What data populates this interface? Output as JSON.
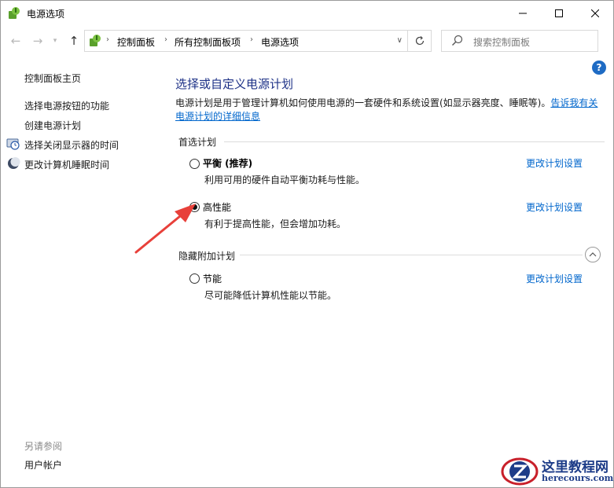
{
  "window": {
    "title": "电源选项",
    "controls": {
      "minimize_icon": "minimize-icon",
      "maximize_icon": "maximize-icon",
      "close_icon": "close-icon"
    }
  },
  "nav": {
    "breadcrumbs": [
      "控制面板",
      "所有控制面板项",
      "电源选项"
    ],
    "search_placeholder": "搜索控制面板"
  },
  "sidebar": {
    "home_link": "控制面板主页",
    "links": [
      {
        "label": "选择电源按钮的功能",
        "icon": ""
      },
      {
        "label": "创建电源计划",
        "icon": ""
      },
      {
        "label": "选择关闭显示器的时间",
        "icon": "display-clock-icon"
      },
      {
        "label": "更改计算机睡眠时间",
        "icon": "moon-icon"
      }
    ],
    "see_also_title": "另请参阅",
    "see_also_links": [
      "用户帐户"
    ]
  },
  "main": {
    "title": "选择或自定义电源计划",
    "description": "电源计划是用于管理计算机如何使用电源的一套硬件和系统设置(如显示器亮度、睡眠等)。",
    "description_link": "告诉我有关电源计划的详细信息",
    "preferred_plans_label": "首选计划",
    "hidden_plans_label": "隐藏附加计划",
    "plans": [
      {
        "name": "平衡 (推荐)",
        "description": "利用可用的硬件自动平衡功耗与性能。",
        "selected": false,
        "change_link": "更改计划设置"
      },
      {
        "name": "高性能",
        "description": "有利于提高性能，但会增加功耗。",
        "selected": true,
        "change_link": "更改计划设置"
      },
      {
        "name": "节能",
        "description": "尽可能降低计算机性能以节能。",
        "selected": false,
        "change_link": "更改计划设置"
      }
    ]
  },
  "watermark": {
    "title": "这里教程网",
    "subtitle": "herecours.com"
  },
  "colors": {
    "accent_title": "#1e3287",
    "link": "#0066cc",
    "annotation_arrow": "#e8403a"
  }
}
